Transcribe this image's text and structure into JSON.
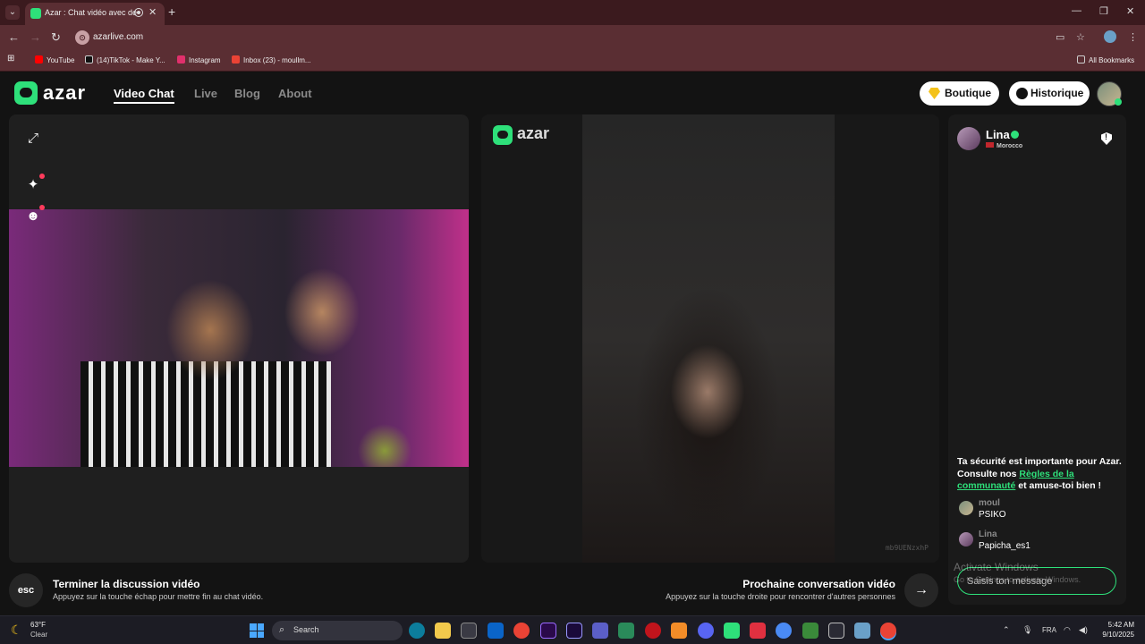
{
  "browser": {
    "tab_title": "Azar : Chat vidéo avec de n",
    "url": "azarlive.com",
    "bookmarks": [
      {
        "label": "YouTube",
        "color": "#ff0000"
      },
      {
        "label": "(14)TikTok - Make Y...",
        "color": "#111111"
      },
      {
        "label": "Instagram",
        "color": "#e1306c"
      },
      {
        "label": "Inbox (23) - moullm...",
        "color": "#ea4335"
      }
    ],
    "all_bookmarks": "All Bookmarks"
  },
  "header": {
    "logo": "azar",
    "nav": [
      "Video Chat",
      "Live",
      "Blog",
      "About"
    ],
    "active_nav": "Video Chat",
    "boutique_label": "Boutique",
    "historique_label": "Historique"
  },
  "video": {
    "remote_logo": "azar",
    "session_code": "mb9UENzxhP"
  },
  "chat": {
    "partner": {
      "name": "Lina",
      "country": "Morocco"
    },
    "safety_text_1": "Ta sécurité est importante pour Azar. Consulte nos ",
    "safety_link": "Règles de la communauté",
    "safety_text_2": " et amuse-toi bien !",
    "messages": [
      {
        "author": "moul",
        "text": "PSIKO"
      },
      {
        "author": "Lina",
        "text": "Papicha_es1"
      }
    ],
    "input_placeholder": "Saisis ton message"
  },
  "footer": {
    "esc_key": "esc",
    "end_title": "Terminer la discussion vidéo",
    "end_sub": "Appuyez sur la touche échap pour mettre fin au chat vidéo.",
    "next_title": "Prochaine conversation vidéo",
    "next_sub": "Appuyez sur la touche droite pour rencontrer d'autres personnes"
  },
  "windows": {
    "activate_title": "Activate Windows",
    "activate_sub": "Go to Settings to activate Windows."
  },
  "taskbar": {
    "temperature": "63°F",
    "weather": "Clear",
    "search_label": "Search",
    "language": "FRA",
    "time": "5:42 AM",
    "date": "9/10/2025"
  },
  "colors": {
    "accent": "#2ee07a",
    "browser_frame": "#5a2e33",
    "page_bg": "#131313"
  }
}
